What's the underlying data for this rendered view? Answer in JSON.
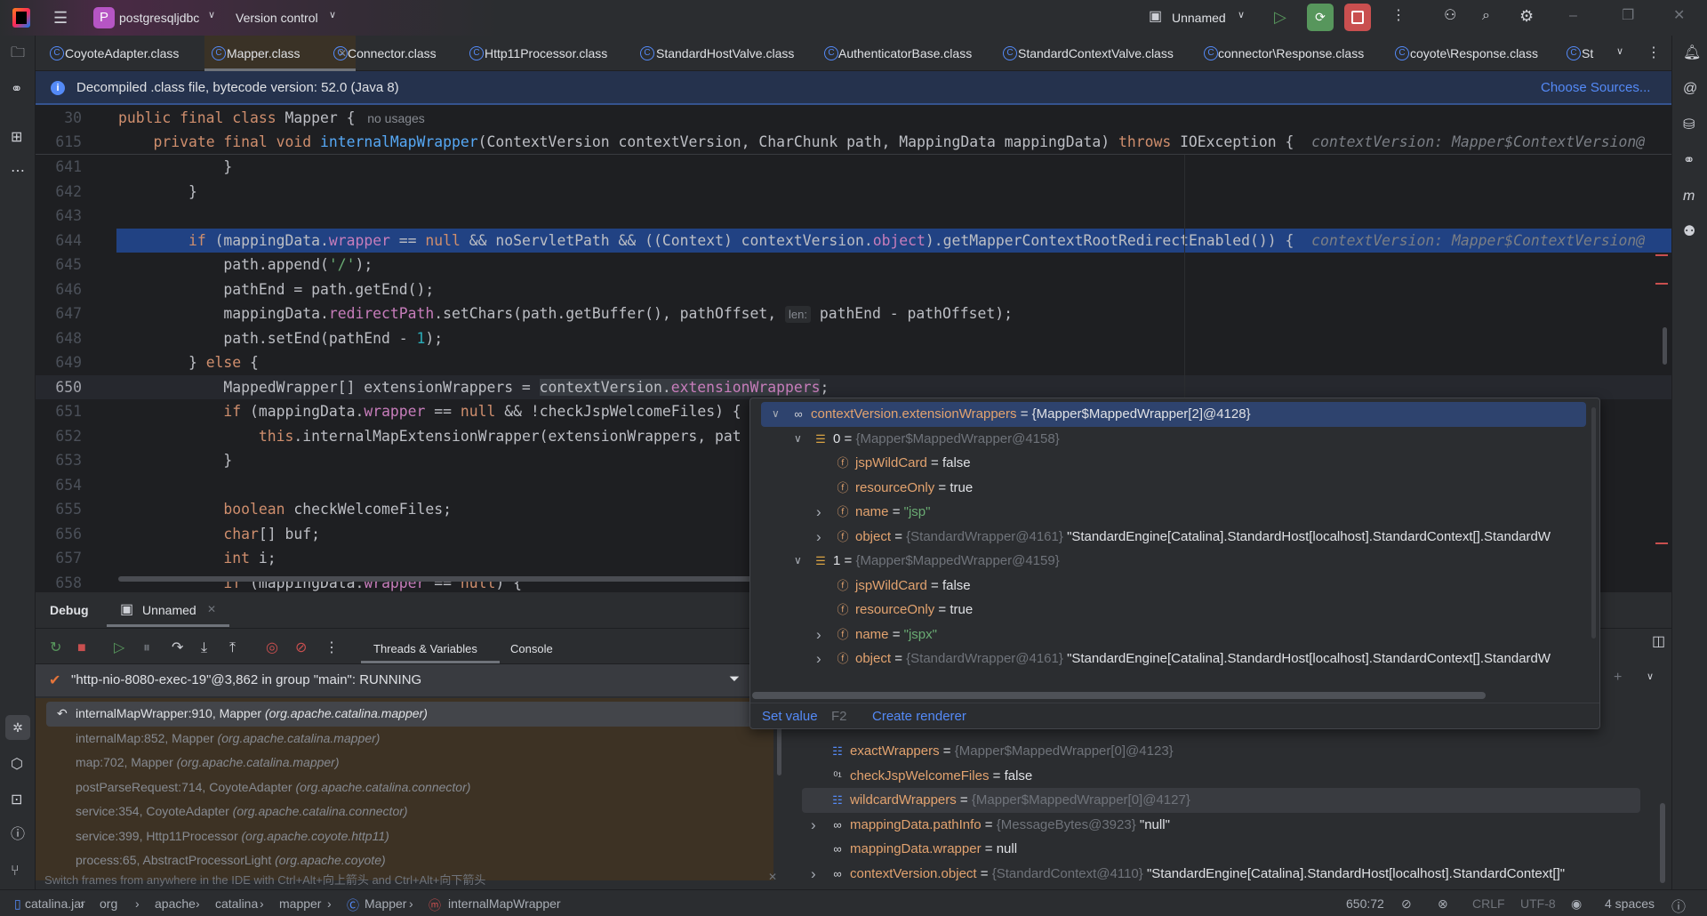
{
  "titlebar": {
    "project_initial": "P",
    "project": "postgresqljdbc",
    "vcs": "Version control",
    "run_config": "Unnamed"
  },
  "tabs": [
    {
      "label": "CoyoteAdapter.class"
    },
    {
      "label": "Mapper.class",
      "active": true
    },
    {
      "label": "Connector.class"
    },
    {
      "label": "Http11Processor.class"
    },
    {
      "label": "StandardHostValve.class"
    },
    {
      "label": "AuthenticatorBase.class"
    },
    {
      "label": "StandardContextValve.class"
    },
    {
      "label": "connector\\Response.class"
    },
    {
      "label": "coyote\\Response.class"
    },
    {
      "label": "St"
    }
  ],
  "banner": {
    "text": "Decompiled .class file, bytecode version: 52.0 (Java 8)",
    "action": "Choose Sources..."
  },
  "sticky": [
    {
      "num": "30",
      "tokens": [
        [
          "k",
          "public final class "
        ],
        [
          "p",
          "Mapper { "
        ],
        [
          "h2",
          " no usages"
        ]
      ]
    },
    {
      "num": "615",
      "tokens": [
        [
          "p",
          "    "
        ],
        [
          "k",
          "private final void "
        ],
        [
          "m",
          "internalMapWrapper"
        ],
        [
          "p",
          "(ContextVersion contextVersion, CharChunk path, MappingData mappingData) "
        ],
        [
          "k",
          "throws "
        ],
        [
          "p",
          "IOException {  "
        ],
        [
          "h",
          "contextVersion: Mapper$ContextVersion@"
        ]
      ]
    }
  ],
  "code": [
    {
      "num": "641",
      "tokens": [
        [
          "p",
          "            }"
        ]
      ]
    },
    {
      "num": "642",
      "tokens": [
        [
          "p",
          "        }"
        ]
      ]
    },
    {
      "num": "643",
      "tokens": []
    },
    {
      "num": "644",
      "exec": true,
      "tokens": [
        [
          "p",
          "        "
        ],
        [
          "k",
          "if "
        ],
        [
          "p",
          "(mappingData."
        ],
        [
          "f",
          "wrapper"
        ],
        [
          "p",
          " == "
        ],
        [
          "k",
          "null"
        ],
        [
          "p",
          " && noServletPath && ((Context) contextVersion."
        ],
        [
          "f",
          "object"
        ],
        [
          "p",
          ").getMapperContextRootRedirectEnabled()) {  "
        ],
        [
          "h",
          "contextVersion: Mapper$ContextVersion@"
        ]
      ]
    },
    {
      "num": "645",
      "tokens": [
        [
          "p",
          "            path.append("
        ],
        [
          "s",
          "'/'"
        ],
        [
          "p",
          ");"
        ]
      ]
    },
    {
      "num": "646",
      "tokens": [
        [
          "p",
          "            pathEnd = path.getEnd();"
        ]
      ]
    },
    {
      "num": "647",
      "tokens": [
        [
          "p",
          "            mappingData."
        ],
        [
          "f",
          "redirectPath"
        ],
        [
          "p",
          ".setChars(path.getBuffer(), pathOffset, "
        ],
        [
          "pl",
          "len:"
        ],
        [
          "p",
          " pathEnd - pathOffset);"
        ]
      ]
    },
    {
      "num": "648",
      "tokens": [
        [
          "p",
          "            path.setEnd(pathEnd - "
        ],
        [
          "n",
          "1"
        ],
        [
          "p",
          ");"
        ]
      ]
    },
    {
      "num": "649",
      "tokens": [
        [
          "p",
          "        } "
        ],
        [
          "k",
          "else"
        ],
        [
          "p",
          " {"
        ]
      ]
    },
    {
      "num": "650",
      "current": true,
      "tokens": [
        [
          "p",
          "            MappedWrapper[] extensionWrappers = "
        ],
        [
          "hl",
          "contextVersion."
        ],
        [
          "hlf",
          "extensionWrappers"
        ],
        [
          "p",
          ";"
        ]
      ]
    },
    {
      "num": "651",
      "tokens": [
        [
          "p",
          "            "
        ],
        [
          "k",
          "if "
        ],
        [
          "p",
          "(mappingData."
        ],
        [
          "f",
          "wrapper"
        ],
        [
          "p",
          " == "
        ],
        [
          "k",
          "null"
        ],
        [
          "p",
          " && !checkJspWelcomeFiles) {"
        ]
      ]
    },
    {
      "num": "652",
      "tokens": [
        [
          "p",
          "                "
        ],
        [
          "k",
          "this"
        ],
        [
          "p",
          ".internalMapExtensionWrapper(extensionWrappers, pat"
        ]
      ]
    },
    {
      "num": "653",
      "tokens": [
        [
          "p",
          "            }"
        ]
      ]
    },
    {
      "num": "654",
      "tokens": []
    },
    {
      "num": "655",
      "tokens": [
        [
          "p",
          "            "
        ],
        [
          "k",
          "boolean "
        ],
        [
          "p",
          "checkWelcomeFiles;"
        ]
      ]
    },
    {
      "num": "656",
      "tokens": [
        [
          "p",
          "            "
        ],
        [
          "k",
          "char"
        ],
        [
          "p",
          "[] buf;"
        ]
      ]
    },
    {
      "num": "657",
      "tokens": [
        [
          "p",
          "            "
        ],
        [
          "k",
          "int "
        ],
        [
          "p",
          "i;"
        ]
      ]
    },
    {
      "num": "658",
      "tokens": [
        [
          "p",
          "            "
        ],
        [
          "k",
          "if "
        ],
        [
          "p",
          "(mappingData."
        ],
        [
          "f",
          "wrapper"
        ],
        [
          "p",
          " == "
        ],
        [
          "k",
          "null"
        ],
        [
          "p",
          ") {"
        ]
      ]
    }
  ],
  "debug": {
    "title": "Debug",
    "session_tab": "Unnamed",
    "tabs": [
      "Threads & Variables",
      "Console"
    ],
    "thread": "\"http-nio-8080-exec-19\"@3,862 in group \"main\": RUNNING",
    "frames": [
      {
        "method": "internalMapWrapper:910, Mapper",
        "pkg": "(org.apache.catalina.mapper)",
        "selected": true
      },
      {
        "method": "internalMap:852, Mapper",
        "pkg": "(org.apache.catalina.mapper)"
      },
      {
        "method": "map:702, Mapper",
        "pkg": "(org.apache.catalina.mapper)"
      },
      {
        "method": "postParseRequest:714, CoyoteAdapter",
        "pkg": "(org.apache.catalina.connector)"
      },
      {
        "method": "service:354, CoyoteAdapter",
        "pkg": "(org.apache.catalina.connector)"
      },
      {
        "method": "service:399, Http11Processor",
        "pkg": "(org.apache.coyote.http11)"
      },
      {
        "method": "process:65, AbstractProcessorLight",
        "pkg": "(org.apache.coyote)"
      }
    ],
    "hint": "Switch frames from anywhere in the IDE with Ctrl+Alt+向上箭头 and Ctrl+Alt+向下箭头",
    "variables": [
      {
        "chev": "",
        "icon": "array",
        "name": "exactWrappers",
        "gray": "{Mapper$MappedWrapper[0]@4123}",
        "val": ""
      },
      {
        "chev": "",
        "icon": "bool",
        "name": "checkJspWelcomeFiles",
        "gray": "",
        "val": "false"
      },
      {
        "chev": "",
        "icon": "array",
        "name": "wildcardWrappers",
        "gray": "{Mapper$MappedWrapper[0]@4127}",
        "val": "",
        "selected": true
      },
      {
        "chev": "right",
        "icon": "watch",
        "name": "mappingData.pathInfo",
        "gray": "{MessageBytes@3923}",
        "val": "\"null\""
      },
      {
        "chev": "",
        "icon": "watch",
        "name": "mappingData.wrapper",
        "gray": "",
        "val": "null"
      },
      {
        "chev": "right",
        "icon": "watch",
        "name": "contextVersion.object",
        "gray": "{StandardContext@4110}",
        "val": "\"StandardEngine[Catalina].StandardHost[localhost].StandardContext[]\""
      }
    ]
  },
  "popup": {
    "rows": [
      {
        "level": 0,
        "chev": "down",
        "icon": "watch",
        "name": "contextVersion.extensionWrappers",
        "gray": "",
        "val": "{Mapper$MappedWrapper[2]@4128}",
        "selected": true
      },
      {
        "level": 1,
        "chev": "down",
        "icon": "element",
        "name": "0",
        "gray": "{Mapper$MappedWrapper@4158}",
        "val": ""
      },
      {
        "level": 2,
        "chev": "",
        "icon": "field",
        "name": "jspWildCard",
        "gray": "",
        "val": "false"
      },
      {
        "level": 2,
        "chev": "",
        "icon": "field",
        "name": "resourceOnly",
        "gray": "",
        "val": "true"
      },
      {
        "level": 2,
        "chev": "right",
        "icon": "field",
        "name": "name",
        "gray": "",
        "val": "\"jsp\"",
        "str": true
      },
      {
        "level": 2,
        "chev": "right",
        "icon": "field",
        "name": "object",
        "gray": "{StandardWrapper@4161}",
        "val": "\"StandardEngine[Catalina].StandardHost[localhost].StandardContext[].StandardW"
      },
      {
        "level": 1,
        "chev": "down",
        "icon": "element",
        "name": "1",
        "gray": "{Mapper$MappedWrapper@4159}",
        "val": ""
      },
      {
        "level": 2,
        "chev": "",
        "icon": "field",
        "name": "jspWildCard",
        "gray": "",
        "val": "false"
      },
      {
        "level": 2,
        "chev": "",
        "icon": "field",
        "name": "resourceOnly",
        "gray": "",
        "val": "true"
      },
      {
        "level": 2,
        "chev": "right",
        "icon": "field",
        "name": "name",
        "gray": "",
        "val": "\"jspx\"",
        "str": true
      },
      {
        "level": 2,
        "chev": "right",
        "icon": "field",
        "name": "object",
        "gray": "{StandardWrapper@4161}",
        "val": "\"StandardEngine[Catalina].StandardHost[localhost].StandardContext[].StandardW"
      }
    ],
    "set_value": "Set value",
    "set_value_key": "F2",
    "create_renderer": "Create renderer"
  },
  "statusbar": {
    "breadcrumb": [
      "catalina.jar",
      "org",
      "apache",
      "catalina",
      "mapper",
      "Mapper",
      "internalMapWrapper"
    ],
    "position": "650:72",
    "line_sep": "CRLF",
    "encoding": "UTF-8",
    "indent": "4 spaces"
  },
  "colors": {
    "accent": "#548af7",
    "exec_line": "#214283",
    "run_green": "#57965c",
    "stop_red": "#c94f4f",
    "keyword": "#cf8e6d",
    "field": "#c77dbb",
    "method": "#56a8f5",
    "string": "#6aab73"
  }
}
